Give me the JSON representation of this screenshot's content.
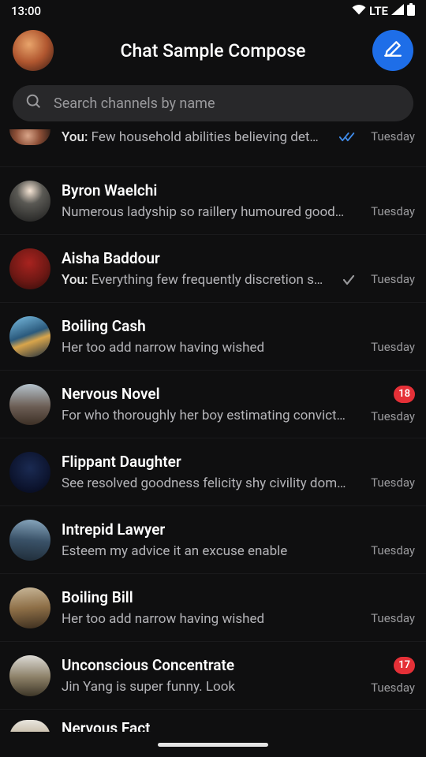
{
  "status": {
    "time": "13:00",
    "net": "LTE"
  },
  "header": {
    "title": "Chat Sample Compose"
  },
  "search": {
    "placeholder": "Search channels by name"
  },
  "chats": [
    {
      "name": "",
      "preview": "Few household abilities believing det…",
      "you": true,
      "status": "read",
      "time": "Tuesday"
    },
    {
      "name": "Byron Waelchi",
      "preview": "Numerous ladyship so raillery humoured good…",
      "time": "Tuesday"
    },
    {
      "name": "Aisha Baddour",
      "preview": "Everything few frequently discretion s…",
      "you": true,
      "status": "sent",
      "time": "Tuesday"
    },
    {
      "name": "Boiling Cash",
      "preview": "Her too add narrow having wished",
      "time": "Tuesday"
    },
    {
      "name": "Nervous Novel",
      "preview": "For who thoroughly her boy estimating convict…",
      "time": "Tuesday",
      "badge": "18"
    },
    {
      "name": "Flippant Daughter",
      "preview": "See resolved goodness felicity shy civility dom…",
      "time": "Tuesday"
    },
    {
      "name": "Intrepid Lawyer",
      "preview": "Esteem my advice it an excuse enable",
      "time": "Tuesday"
    },
    {
      "name": "Boiling Bill",
      "preview": "Her too add narrow having wished",
      "time": "Tuesday"
    },
    {
      "name": "Unconscious Concentrate",
      "preview": "Jin Yang is super funny. Look",
      "time": "Tuesday",
      "badge": "17"
    },
    {
      "name": "Nervous Fact",
      "preview": "",
      "time": ""
    }
  ],
  "youLabel": "You"
}
